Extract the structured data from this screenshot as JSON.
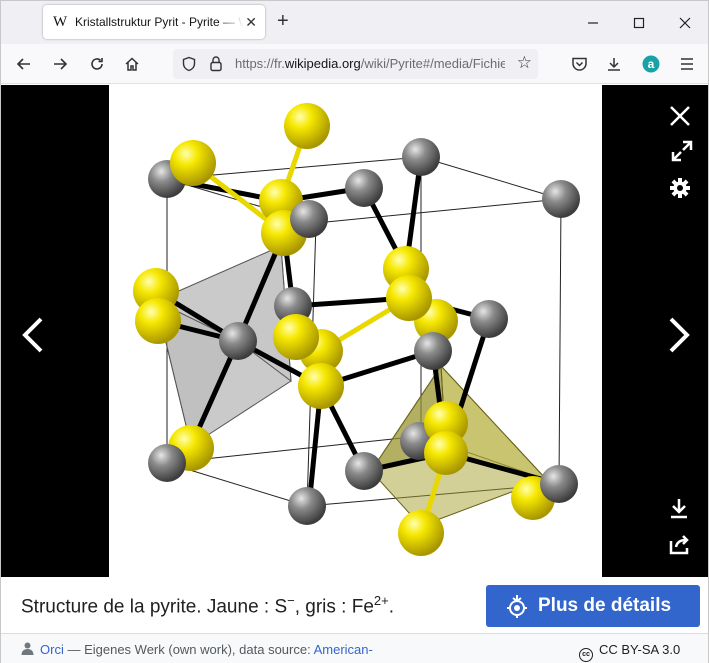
{
  "browser": {
    "tab_title": "Kristallstruktur Pyrit - Pyrite — Wikipédia",
    "tab_favicon": "W",
    "url_prefix": "https://fr.",
    "url_domain": "wikipedia.org",
    "url_path": "/wiki/Pyrite#/media/Fichier:Kristallstruktur_Pyrit.png"
  },
  "caption": {
    "text": "Structure de la pyrite. Jaune : S",
    "s_sup": "−",
    "text_mid": ", gris : Fe",
    "fe_sup": "2+",
    "text_end": "."
  },
  "details_button": {
    "label": "Plus de détails"
  },
  "footer": {
    "author": "Orci",
    "attribution": " — Eigenes Werk (own work), data source: ",
    "source_link": "American-",
    "license": "CC BY-SA 3.0"
  },
  "colors": {
    "sulfur": "#f0e000",
    "iron": "#7a7a7a",
    "button": "#3366cc"
  }
}
